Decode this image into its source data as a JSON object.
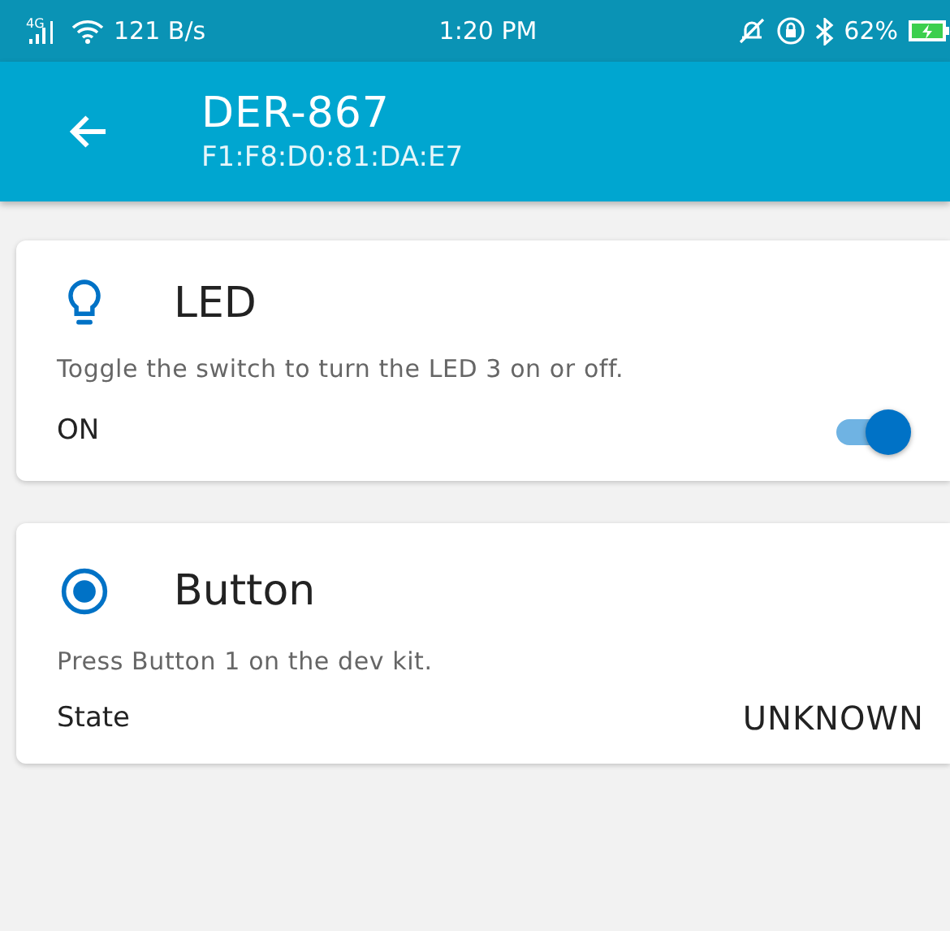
{
  "status_bar": {
    "network": "4G",
    "speed": "121 B/s",
    "time": "1:20 PM",
    "battery": "62%",
    "charging": true
  },
  "header": {
    "title": "DER-867",
    "subtitle": "F1:F8:D0:81:DA:E7"
  },
  "cards": [
    {
      "kind": "switch",
      "title": "LED",
      "description": "Toggle the switch to turn the LED 3 on or off.",
      "label": "ON",
      "on": true
    },
    {
      "kind": "state",
      "title": "Button",
      "description": "Press Button 1 on the dev kit.",
      "label": "State",
      "value": "UNKNOWN"
    }
  ]
}
